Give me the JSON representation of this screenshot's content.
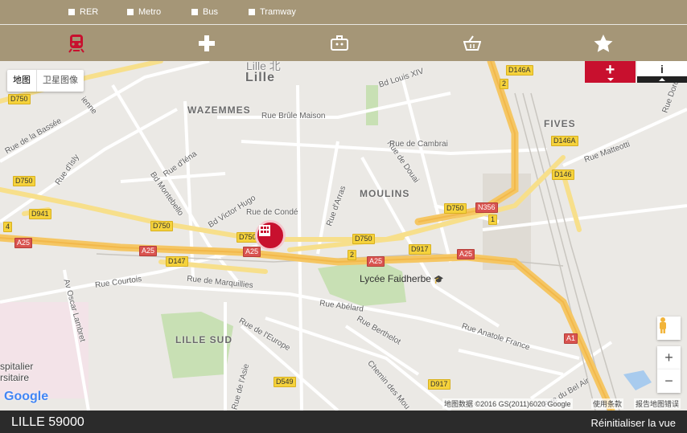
{
  "filters": [
    {
      "label": "RER"
    },
    {
      "label": "Metro"
    },
    {
      "label": "Bus"
    },
    {
      "label": "Tramway"
    }
  ],
  "categories": [
    "train-icon",
    "health-cross-icon",
    "briefcase-icon",
    "shopping-basket-icon",
    "star-icon"
  ],
  "map": {
    "type_tabs": [
      "地图",
      "卫星图像"
    ],
    "active_type": "地图",
    "districts": [
      "WAZEMMES",
      "FIVES",
      "MOULINS",
      "LILLE SUD",
      "Lille"
    ],
    "streets": [
      "Rue Brûle Maison",
      "Bd Louis XIV",
      "Rue Dordin",
      "Rue de la Bassée",
      "Rue d'Isly",
      "Rue d'Iéna",
      "Bd Montebello",
      "Bd Victor Hugo",
      "Rue de Condé",
      "Rue d'Arras",
      "Rue de Douai",
      "Rue de Cambrai",
      "Rue Matteotti",
      "Rue Courtois",
      "Rue de Marquillies",
      "Av Oscar Lambret",
      "Rue Abélard",
      "Rue Berthelot",
      "Rue Anatole France",
      "Rue de l'Europe",
      "Rue de l'Asie",
      "Chemin des Mou",
      "Rue du Bel Air",
      "spitalier",
      "rsitaire",
      "ienne",
      "Lille 北"
    ],
    "road_shields_yellow": [
      "D750",
      "D750",
      "D941",
      "D750",
      "D750",
      "D147",
      "D750",
      "D750",
      "D917",
      "D146A",
      "D146A",
      "D146",
      "D549",
      "D917",
      "2",
      "2",
      "1",
      "4"
    ],
    "road_shields_red": [
      "A25",
      "A25",
      "A25",
      "A25",
      "A25",
      "N356",
      "A1"
    ],
    "poi": "Lycée Faidherbe",
    "google_logo": "Google",
    "attribution": "地图数据 ©2016 GS(2011)6020 Google",
    "terms": "使用条款",
    "report": "报告地图错误",
    "zoom_in": "+",
    "zoom_out": "−",
    "info_label": "i",
    "plus_label": "+"
  },
  "footer": {
    "city": "LILLE 59000",
    "reset": "Réinitialiser la vue"
  },
  "colors": {
    "header": "#a59677",
    "accent_red": "#c8102e",
    "footer": "#2b2b2b"
  }
}
